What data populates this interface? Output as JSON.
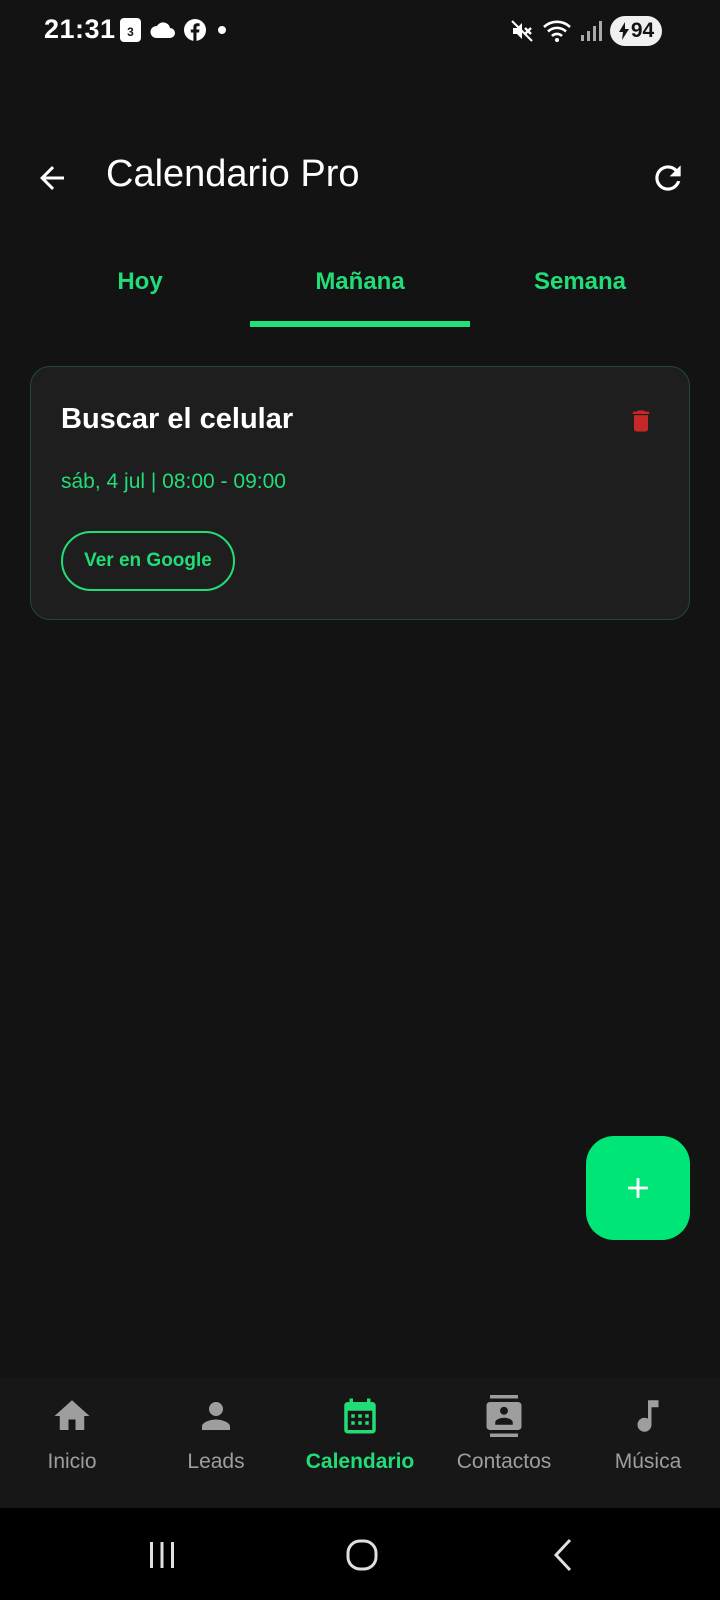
{
  "status_bar": {
    "time": "21:31",
    "calendar_badge": "3",
    "battery_level": "94"
  },
  "app_bar": {
    "title": "Calendario Pro"
  },
  "tabs": [
    {
      "label": "Hoy",
      "active": false
    },
    {
      "label": "Mañana",
      "active": true
    },
    {
      "label": "Semana",
      "active": false
    }
  ],
  "events": [
    {
      "title": "Buscar el celular",
      "datetime": "sáb, 4 jul | 08:00 - 09:00",
      "action_label": "Ver en Google"
    }
  ],
  "bottom_nav": [
    {
      "label": "Inicio",
      "icon": "home-icon",
      "active": false
    },
    {
      "label": "Leads",
      "icon": "person-icon",
      "active": false
    },
    {
      "label": "Calendario",
      "icon": "calendar-icon",
      "active": true
    },
    {
      "label": "Contactos",
      "icon": "contacts-icon",
      "active": false
    },
    {
      "label": "Música",
      "icon": "music-note-icon",
      "active": false
    }
  ],
  "colors": {
    "background": "#131313",
    "accent": "#22dd77",
    "fab": "#00e676",
    "delete": "#c62828",
    "card": "#1e1e1e",
    "inactive_nav": "#9e9e9e"
  }
}
